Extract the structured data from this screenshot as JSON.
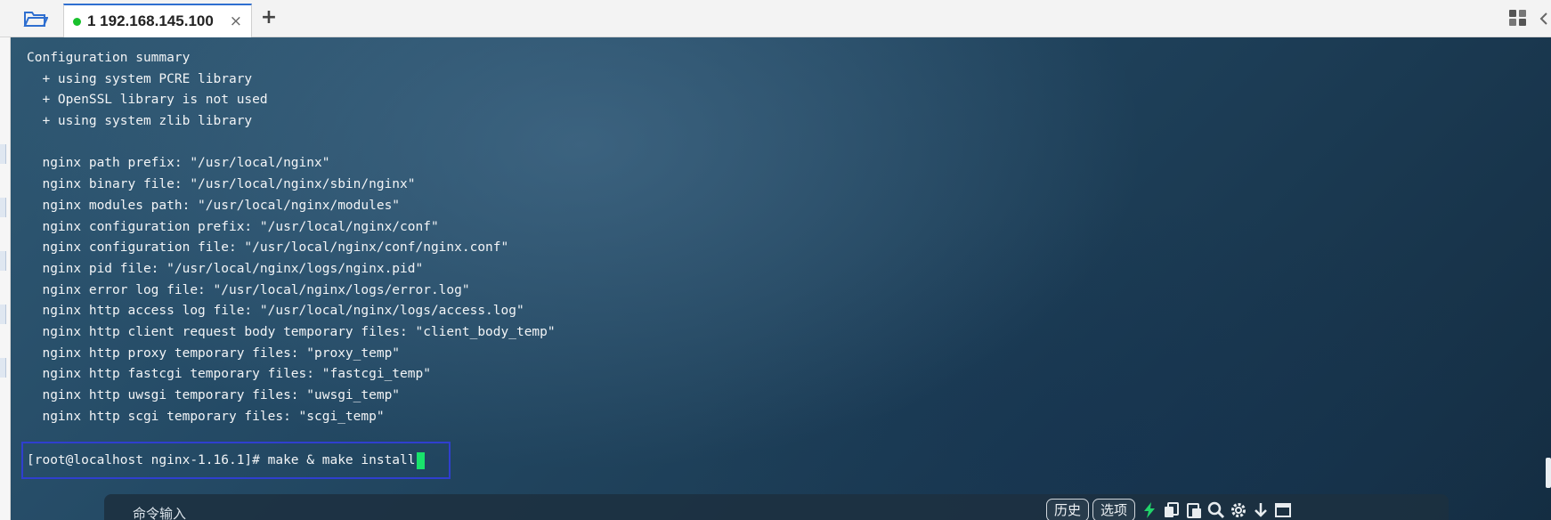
{
  "tabbar": {
    "tab": {
      "label": "1 192.168.145.100",
      "status_color": "#19c12d"
    },
    "close_symbol": "×",
    "add_symbol": "+"
  },
  "terminal": {
    "lines": [
      "Configuration summary",
      "  + using system PCRE library",
      "  + OpenSSL library is not used",
      "  + using system zlib library",
      "",
      "  nginx path prefix: \"/usr/local/nginx\"",
      "  nginx binary file: \"/usr/local/nginx/sbin/nginx\"",
      "  nginx modules path: \"/usr/local/nginx/modules\"",
      "  nginx configuration prefix: \"/usr/local/nginx/conf\"",
      "  nginx configuration file: \"/usr/local/nginx/conf/nginx.conf\"",
      "  nginx pid file: \"/usr/local/nginx/logs/nginx.pid\"",
      "  nginx error log file: \"/usr/local/nginx/logs/error.log\"",
      "  nginx http access log file: \"/usr/local/nginx/logs/access.log\"",
      "  nginx http client request body temporary files: \"client_body_temp\"",
      "  nginx http proxy temporary files: \"proxy_temp\"",
      "  nginx http fastcgi temporary files: \"fastcgi_temp\"",
      "  nginx http uwsgi temporary files: \"uwsgi_temp\"",
      "  nginx http scgi temporary files: \"scgi_temp\""
    ],
    "prompt": "[root@localhost nginx-1.16.1]# make & make install",
    "cursor_color": "#19e36c",
    "highlight_color": "#2f3fcf"
  },
  "command_bar": {
    "placeholder": "命令输入",
    "history_label": "历史",
    "options_label": "选项",
    "icons": [
      "lightning-icon",
      "copy-icon",
      "paste-icon",
      "search-icon",
      "gear-icon",
      "download-icon",
      "window-icon"
    ]
  }
}
